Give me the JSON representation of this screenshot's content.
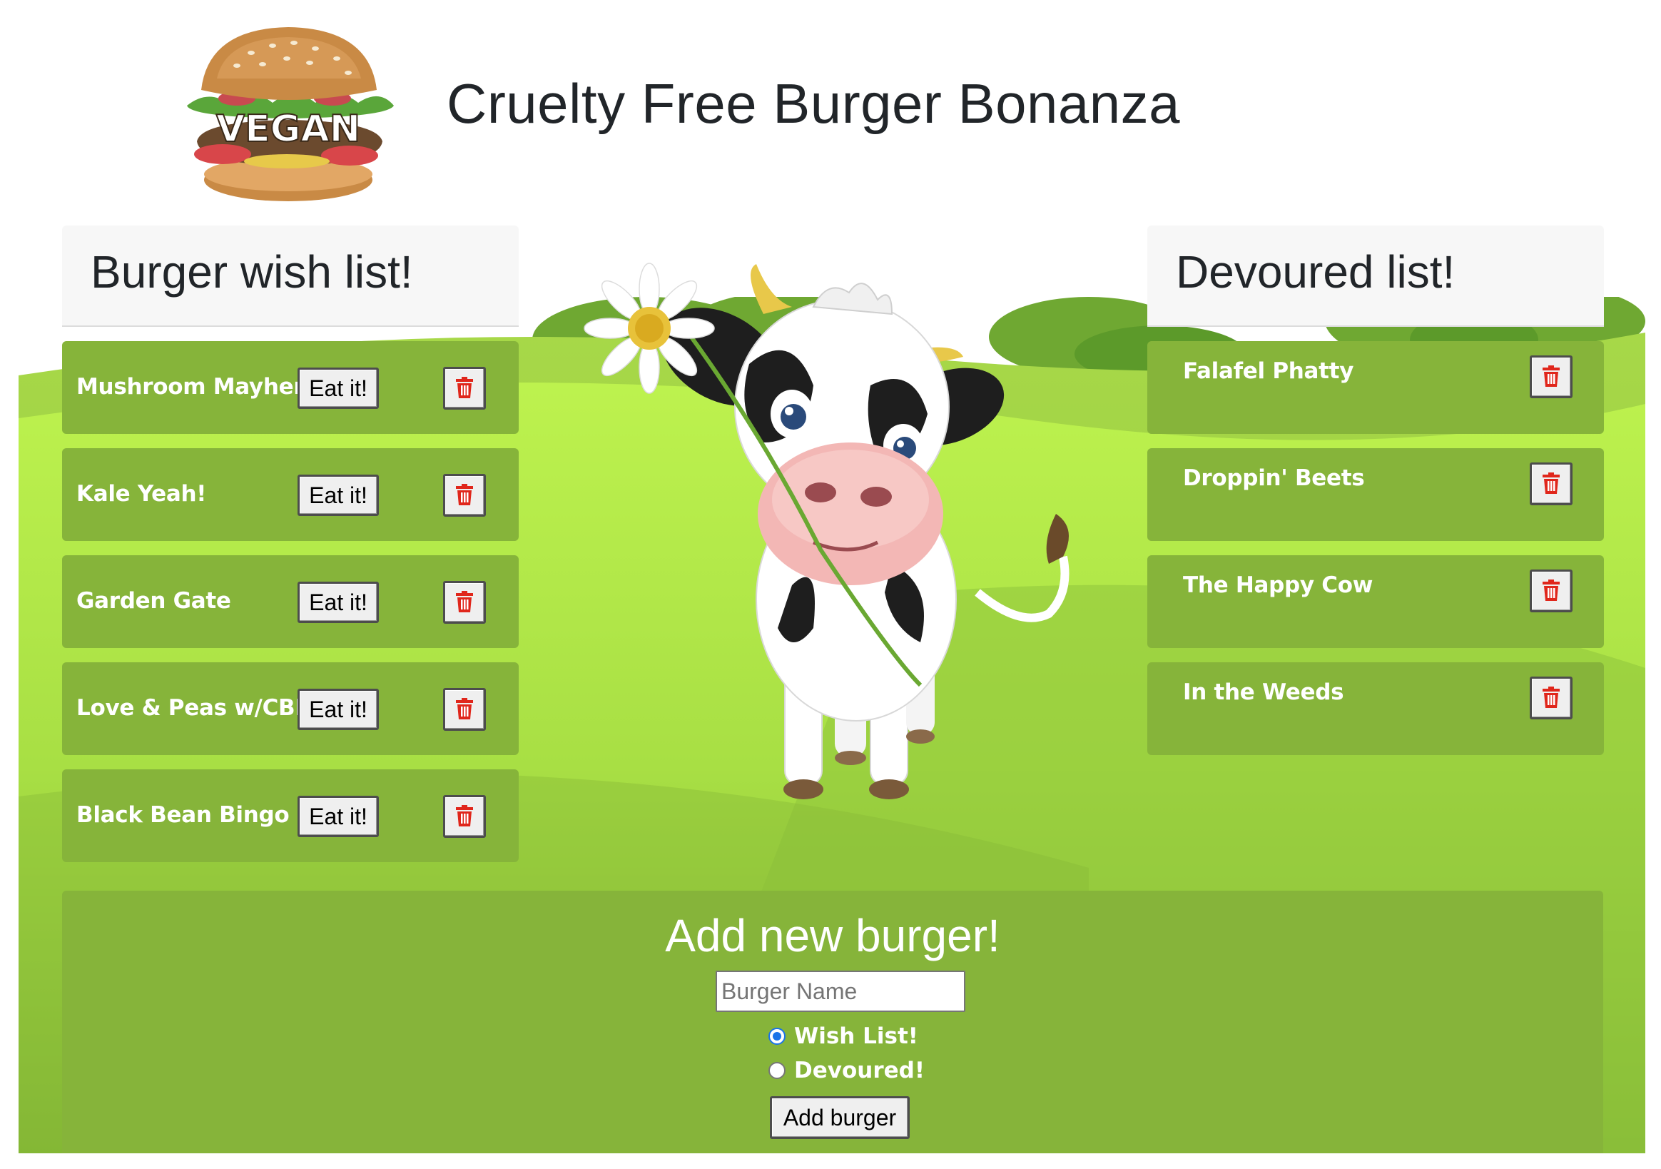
{
  "header": {
    "logo_text": "VEGAN",
    "title": "Cruelty Free Burger Bonanza"
  },
  "wish_list": {
    "title": "Burger wish list!",
    "eat_label": "Eat it!",
    "items": [
      {
        "name": "Mushroom Mayhem"
      },
      {
        "name": "Kale Yeah!"
      },
      {
        "name": "Garden Gate"
      },
      {
        "name": "Love & Peas w/CBD"
      },
      {
        "name": "Black Bean Bingo"
      }
    ]
  },
  "devoured_list": {
    "title": "Devoured list!",
    "items": [
      {
        "name": "Falafel Phatty"
      },
      {
        "name": "Droppin' Beets"
      },
      {
        "name": "The Happy Cow"
      },
      {
        "name": "In the Weeds"
      }
    ]
  },
  "add_form": {
    "title": "Add new burger!",
    "name_placeholder": "Burger Name",
    "name_value": "",
    "options": [
      {
        "label": "Wish List!",
        "checked": true
      },
      {
        "label": "Devoured!",
        "checked": false
      }
    ],
    "submit_label": "Add burger"
  },
  "icons": {
    "delete": "trash-icon",
    "logo": "vegan-burger-logo",
    "mascot": "cow-with-daisy-illustration"
  },
  "colors": {
    "card_green": "#86b43a",
    "meadow_light": "#b7ec4a",
    "meadow_dark": "#7fb235",
    "trash_red": "#e0261b",
    "radio_blue": "#1a73e8"
  }
}
